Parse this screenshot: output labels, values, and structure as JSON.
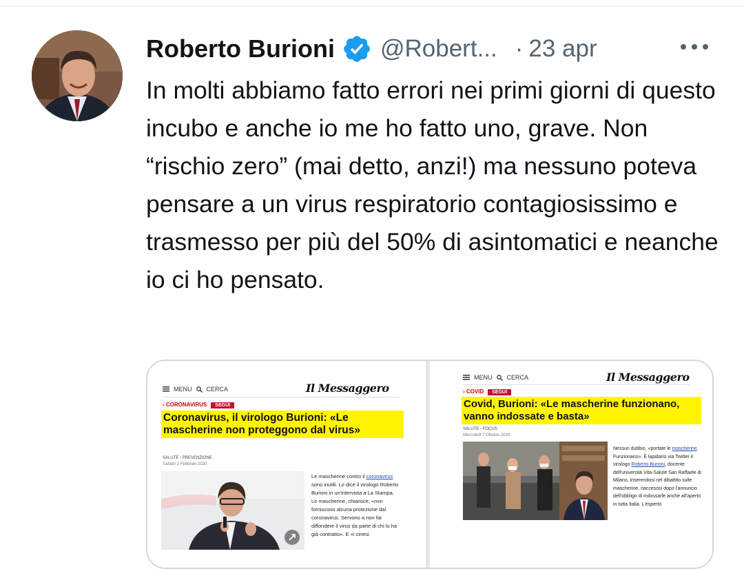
{
  "tweet": {
    "author_name": "Roberto Burioni",
    "handle": "@Robert...",
    "separator": "·",
    "date": "23 apr",
    "text": "In molti abbiamo fatto errori nei primi giorni di questo incubo e anche io me ho fatto uno, grave. Non “rischio zero” (mai detto, anzi!) ma nessuno poteva pensare a un virus respiratorio contagiosissimo e trasmesso per più del 50% di asintomatici e neanche io ci ho pensato."
  },
  "icons": {
    "verified": "verified-badge-icon",
    "more": "more-dots-icon",
    "menu": "hamburger-icon",
    "search": "search-icon",
    "expand": "expand-icon"
  },
  "colors": {
    "accent": "#1d9bf0",
    "muted": "#536471",
    "highlight": "#fff500",
    "brand_red": "#c8102e"
  },
  "media": {
    "left": {
      "menu_label": "MENU",
      "search_label": "CERCA",
      "logo": "Il Messaggero",
      "section": "› CORONAVIRUS",
      "follow": "SEGUI",
      "headline": "Coronavirus, il virologo Burioni: «Le mascherine non proteggono dal virus»",
      "subsection": "SALUTE › PREVENZIONE",
      "date": "Sabato 1 Febbraio 2020",
      "body_1": "Le mascherine contro il ",
      "body_link": "coronavirus",
      "body_2": " sono inutili. Lo dice il virologo Roberto Burioni in un'intervista a La Stampa. Le mascherine, chiarisce, «non forniscono alcuna protezione dal coronavirus. Servono a non far diffondere il virus da parte di chi lo ha già contratto». E «i cinesi"
    },
    "right": {
      "menu_label": "MENU",
      "search_label": "CERCA",
      "logo": "Il Messaggero",
      "section": "› COVID",
      "follow": "SEGUI",
      "headline": "Covid, Burioni: «Le mascherine funzionano, vanno indossate e basta»",
      "subsection": "SALUTE › FOCUS",
      "date": "Mercoledì 7 Ottobre 2020",
      "body_1": "Nessun dubbio, «portate le ",
      "body_link_1": "mascherine",
      "body_2": ". Funzionano». È lapidario via Twitter il virologo ",
      "body_link_2": "Roberto Burioni",
      "body_3": ", docente dell'università Vita-Salute San Raffaele di Milano, inserendosi nel dibattito sulle mascherine, riaccesosi dopo l'annuncio dell'obbligo di indossarle anche all'aperto in tutta Italia. L'esperto"
    }
  }
}
